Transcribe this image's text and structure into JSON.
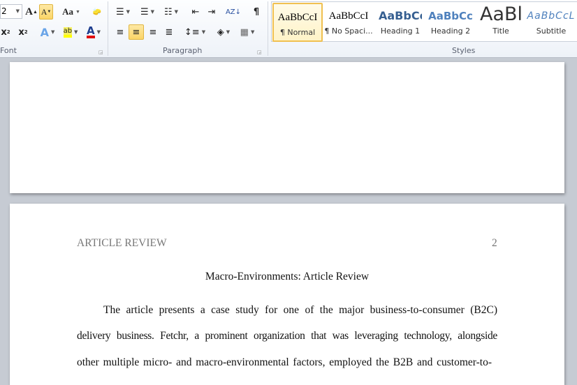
{
  "ribbon": {
    "font": {
      "label": "Font",
      "size_value": "2"
    },
    "paragraph": {
      "label": "Paragraph",
      "show_marks": "¶"
    },
    "styles": {
      "label": "Styles",
      "items": [
        {
          "preview": "AaBbCcI",
          "name": "¶ Normal",
          "selected": true
        },
        {
          "preview": "AaBbCcI",
          "name": "¶ No Spaci..."
        },
        {
          "preview": "AaBbCc",
          "name": "Heading 1"
        },
        {
          "preview": "AaBbCc",
          "name": "Heading 2"
        },
        {
          "preview": "AaBl",
          "name": "Title"
        },
        {
          "preview": "AaBbCcL",
          "name": "Subtitle"
        }
      ]
    }
  },
  "document": {
    "header_left": "ARTICLE REVIEW",
    "page_number": "2",
    "title": "Macro-Environments: Article Review",
    "lines": [
      "The article presents a case study for one of the major business-to-consumer (B2C)",
      "delivery business. Fetchr, a prominent organization that was leveraging technology, alongside",
      "other multiple micro- and macro-environmental factors, employed the B2B and customer-to-"
    ]
  },
  "colors": {
    "highlight": "#ffff00",
    "font_color": "#e01010",
    "heading_blue": "#365f91",
    "doc_bg": "#c6cbd3"
  }
}
